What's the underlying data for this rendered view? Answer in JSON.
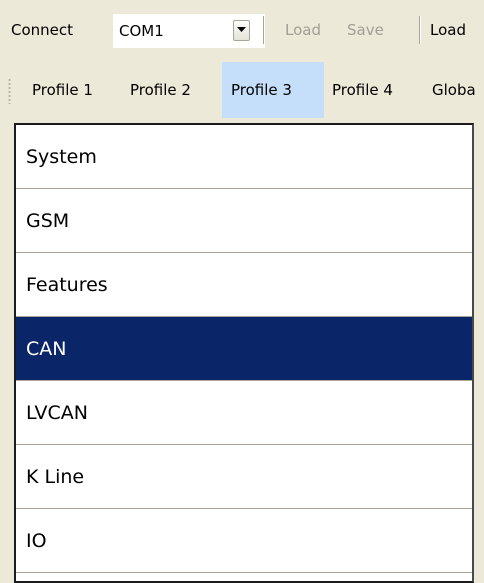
{
  "toolbar": {
    "connect_label": "Connect",
    "port_value": "COM1",
    "load_label": "Load",
    "save_label": "Save",
    "load2_label": "Load"
  },
  "profile_tabs": [
    {
      "label": "Profile 1",
      "active": false
    },
    {
      "label": "Profile 2",
      "active": false
    },
    {
      "label": "Profile 3",
      "active": true
    },
    {
      "label": "Profile 4",
      "active": false
    },
    {
      "label": "Globa",
      "active": false
    }
  ],
  "sections": [
    {
      "label": "System",
      "selected": false
    },
    {
      "label": "GSM",
      "selected": false
    },
    {
      "label": "Features",
      "selected": false
    },
    {
      "label": "CAN",
      "selected": true
    },
    {
      "label": "LVCAN",
      "selected": false
    },
    {
      "label": "K Line",
      "selected": false
    },
    {
      "label": "IO",
      "selected": false
    }
  ],
  "colors": {
    "selection_bg": "#0b2569",
    "active_tab_bg": "#c5defa",
    "disabled_text": "#a19f94"
  }
}
